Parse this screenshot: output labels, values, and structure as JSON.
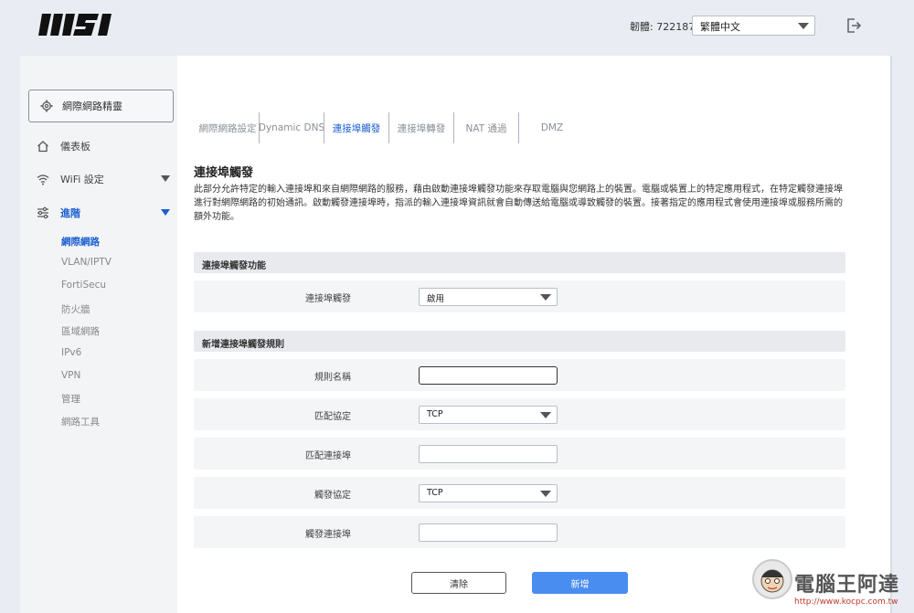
{
  "header": {
    "brand": "MSI",
    "firmware": "韌體: 722187",
    "language": "繁體中文"
  },
  "sidebar": {
    "wizard_label": "網際網路精靈",
    "dashboard": "儀表板",
    "wifi": "WiFi 設定",
    "advanced": "進階",
    "sub_items": [
      "網際網路",
      "VLAN/IPTV",
      "FortiSecu",
      "防火牆",
      "區域網路",
      "IPv6",
      "VPN",
      "管理",
      "網路工具"
    ]
  },
  "tabs": [
    "網際網路設定",
    "Dynamic DNS",
    "連接埠觸發",
    "連接埠轉發",
    "NAT 通過",
    "DMZ"
  ],
  "page": {
    "title": "連接埠觸發",
    "description": "此部分允許特定的輸入連接埠和來自網際網路的服務，藉由啟動連接埠觸發功能來存取電腦與您網路上的裝置。電腦或裝置上的特定應用程式，在特定觸發連接埠進行對網際網路的初始通訊。啟動觸發連接埠時，指派的輸入連接埠資訊就會自動傳送給電腦或導致觸發的裝置。接著指定的應用程式會使用連接埠或服務所需的額外功能。"
  },
  "section1": {
    "title": "連接埠觸發功能",
    "row_label": "連接埠觸發",
    "row_value": "啟用"
  },
  "section2": {
    "title": "新增連接埠觸發規則",
    "rule_name_label": "規則名稱",
    "match_protocol_label": "匹配協定",
    "match_protocol_value": "TCP",
    "match_port_label": "匹配連接埠",
    "trigger_protocol_label": "觸發協定",
    "trigger_protocol_value": "TCP",
    "trigger_port_label": "觸發連接埠"
  },
  "buttons": {
    "clear": "清除",
    "add": "新增"
  },
  "watermark": {
    "text": "電腦王阿達",
    "url": "http://www.kocpc.com.tw"
  },
  "colors": {
    "accent": "#1a5fd0",
    "primary_button": "#4a8df0"
  }
}
